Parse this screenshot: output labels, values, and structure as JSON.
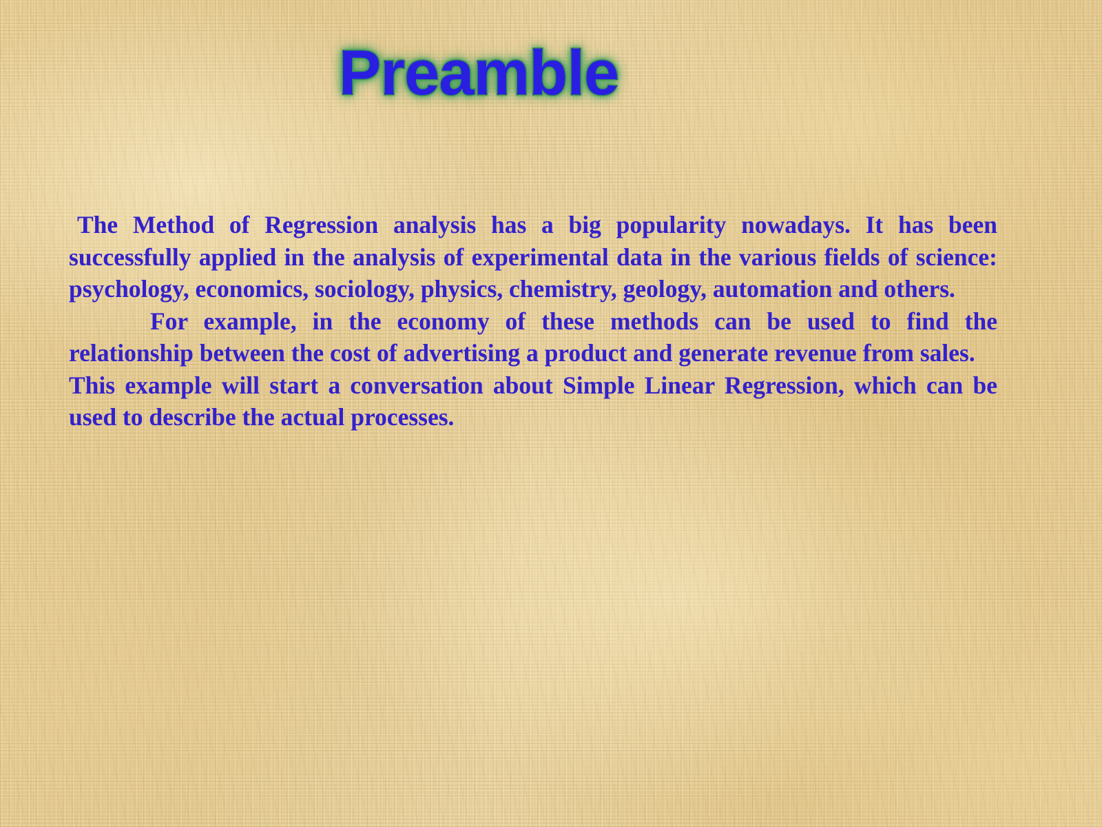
{
  "slide": {
    "title": "Preamble",
    "background_color": "#e8cf97",
    "title_fill_color": "#2a1fe0",
    "title_outline_color": "#1b1560",
    "title_glow_color": "#3fa05a",
    "body_text_color": "#3321cd",
    "paragraphs": [
      " The Method of Regression analysis has a big popularity nowadays. It has been successfully applied in the analysis of experimental data in the various fields of science: psychology, economics, sociology, physics, chemistry, geology, automation and others.",
      "For example, in the economy of these methods can be used to find the relationship between the cost of advertising a product and generate revenue from sales.",
      "This example will start a conversation about Simple Linear Regression, which can be used to describe the actual processes."
    ]
  }
}
